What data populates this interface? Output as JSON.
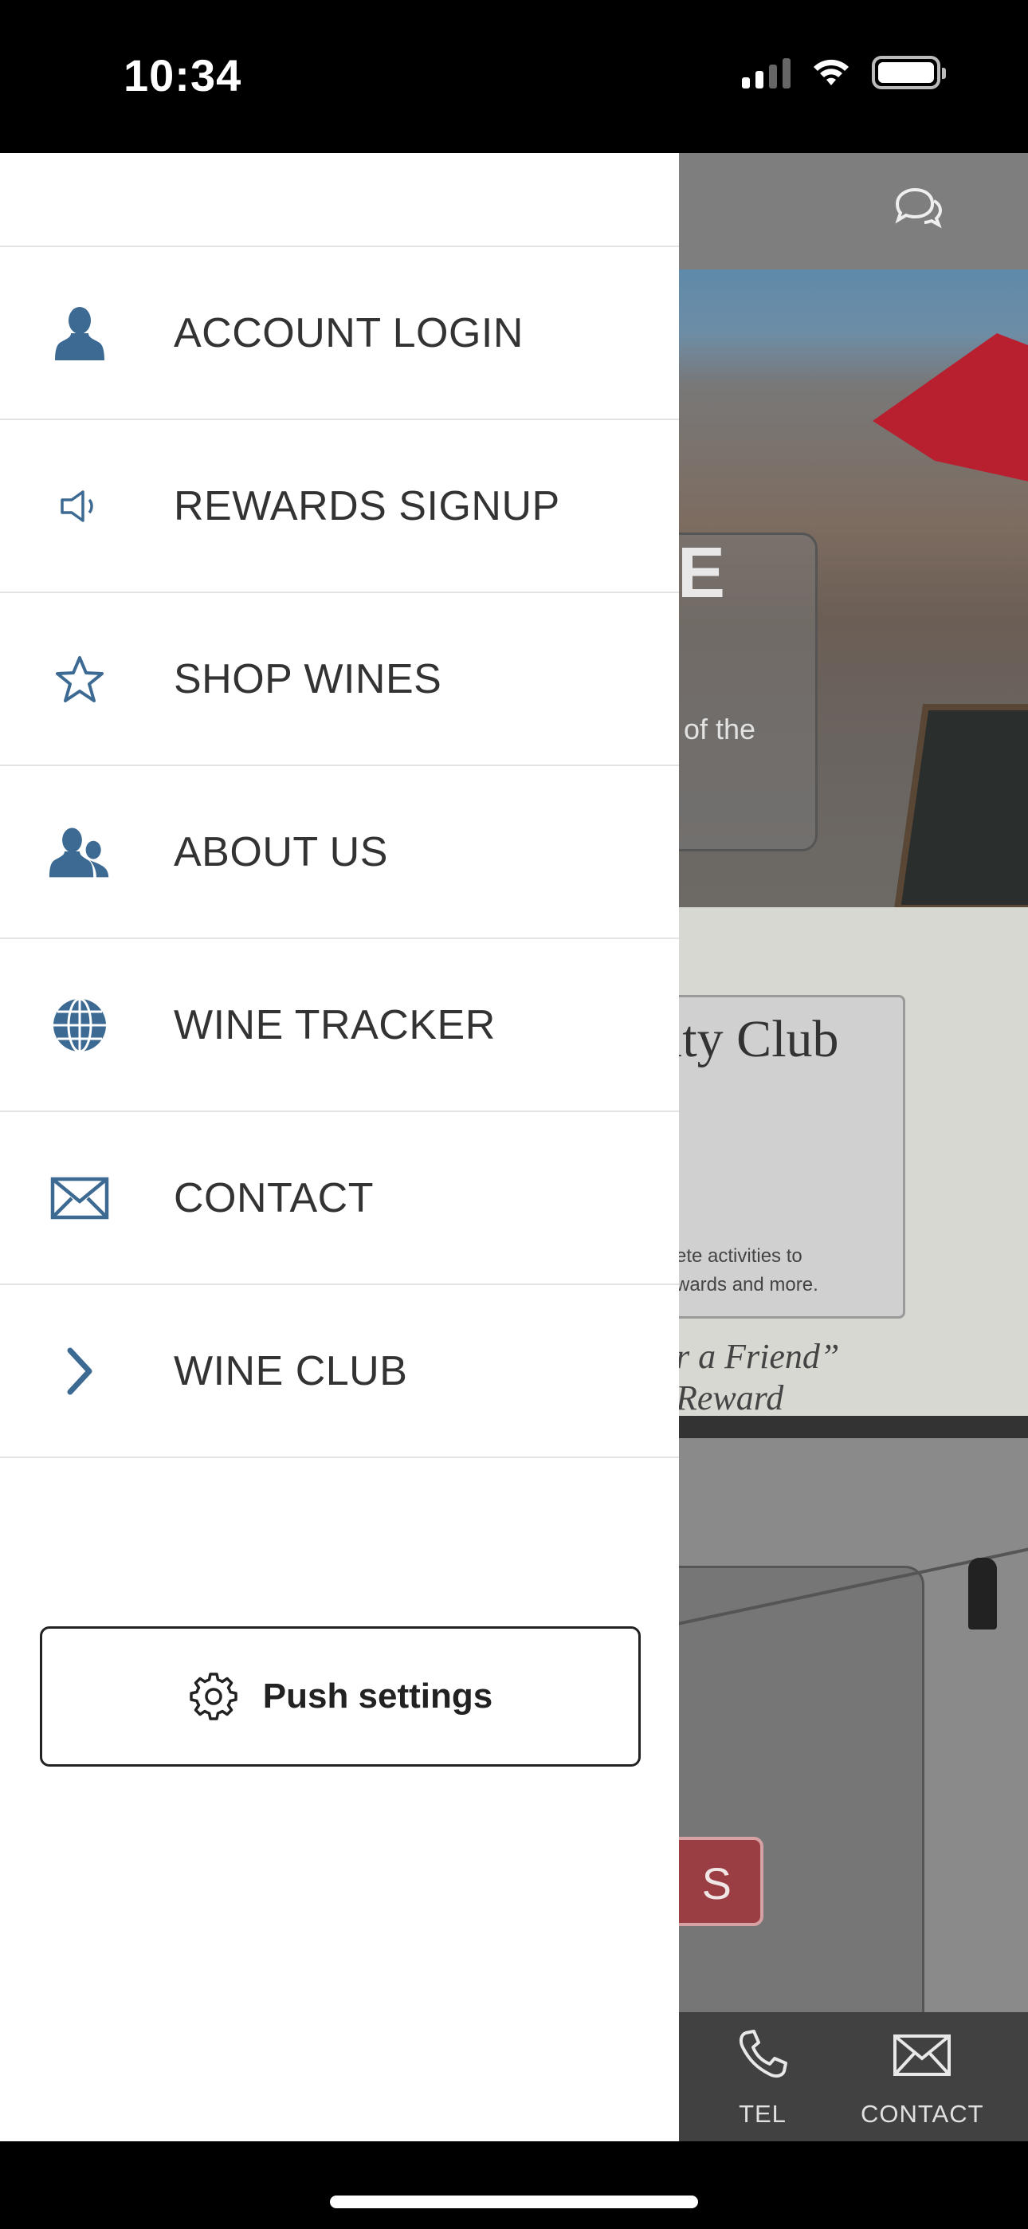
{
  "status_bar": {
    "time": "10:34"
  },
  "background_app": {
    "hero_partial_heading": "E",
    "hero_partial_text": "of the",
    "club_card": {
      "title_partial": "lty Club",
      "line1_partial": "ete activities to",
      "line2_partial": "wards and more.",
      "quote_line1_partial": "r a Friend”",
      "quote_line2_partial": "Reward"
    },
    "button_partial": "S",
    "tab_bar": [
      {
        "label": "TEL",
        "icon": "phone-icon"
      },
      {
        "label": "CONTACT",
        "icon": "envelope-icon"
      }
    ]
  },
  "drawer": {
    "accent_color": "#3d6a93",
    "items": [
      {
        "label": "ACCOUNT LOGIN",
        "icon": "user-icon"
      },
      {
        "label": "REWARDS SIGNUP",
        "icon": "megaphone-icon"
      },
      {
        "label": "SHOP WINES",
        "icon": "star-icon"
      },
      {
        "label": "ABOUT US",
        "icon": "users-icon"
      },
      {
        "label": "WINE TRACKER",
        "icon": "globe-icon"
      },
      {
        "label": "CONTACT",
        "icon": "envelope-icon"
      },
      {
        "label": "WINE CLUB",
        "icon": "chevron-right-icon"
      }
    ],
    "push_settings_label": "Push settings"
  }
}
